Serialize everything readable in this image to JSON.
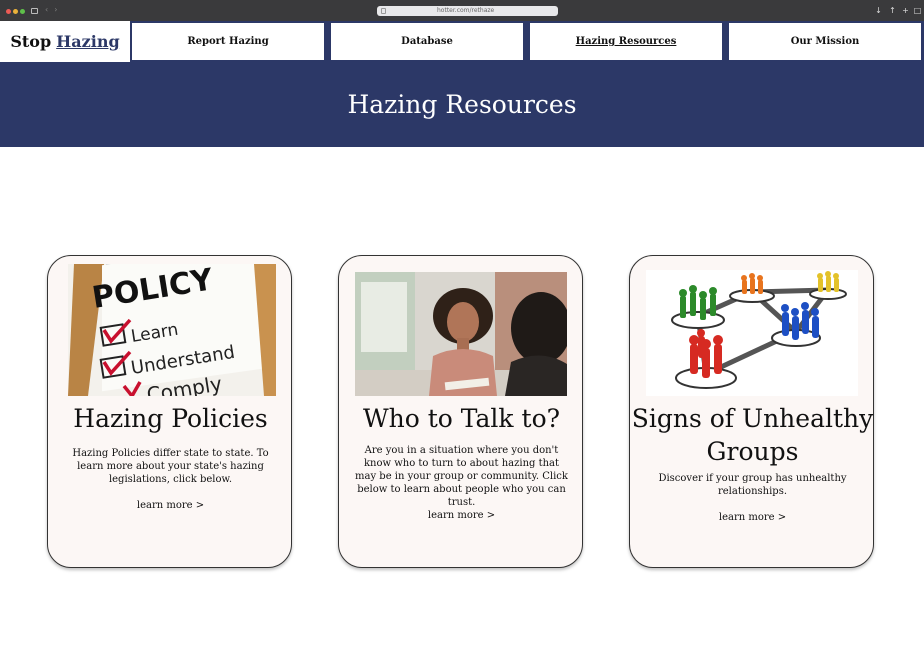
{
  "browser": {
    "url": "hotter.com/rethaze"
  },
  "brand": {
    "part1": "Stop",
    "part2": "Hazing"
  },
  "nav": {
    "report": "Report Hazing",
    "database": "Database",
    "resources": "Hazing Resources",
    "mission": "Our Mission"
  },
  "hero": {
    "title": "Hazing Resources"
  },
  "cards": [
    {
      "title": "Hazing Policies",
      "description": "Hazing Policies differ state to state. To learn more about your state's hazing legislations, click below.",
      "link": "learn more >",
      "image": {
        "heading": "POLICY",
        "items": [
          "Learn",
          "Understand",
          "Comply"
        ]
      }
    },
    {
      "title": "Who to Talk to?",
      "description": "Are you in a situation where you don't know who to turn to about hazing that may be in your group or community. Click below to learn about people who you can trust.",
      "link": "learn more >"
    },
    {
      "title_line1": "Signs of Unhealthy",
      "title_line2": "Groups",
      "description": "Discover if your group has unhealthy relationships.",
      "link": "learn more >"
    }
  ],
  "colors": {
    "navy": "#2c3867",
    "card_bg": "#fcf7f5"
  }
}
